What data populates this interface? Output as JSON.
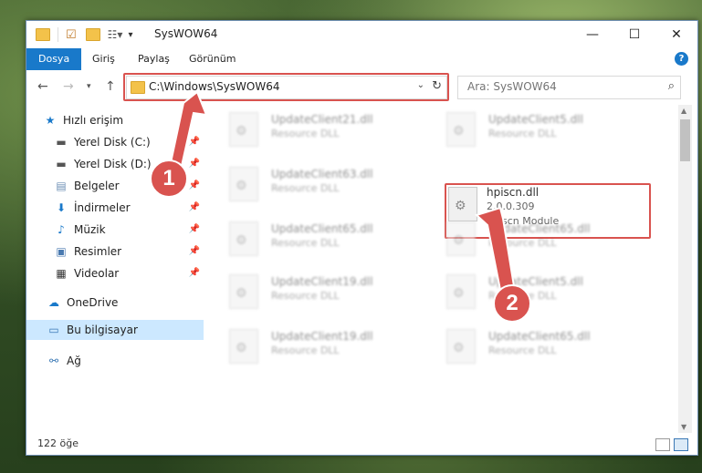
{
  "window": {
    "title": "SysWOW64",
    "buttons": {
      "minimize": "—",
      "maximize": "☐",
      "close": "✕"
    }
  },
  "ribbon": {
    "tabs": [
      "Dosya",
      "Giriş",
      "Paylaş",
      "Görünüm"
    ],
    "help": "?"
  },
  "nav": {
    "address": "C:\\Windows\\SysWOW64",
    "search_placeholder": "Ara: SysWOW64"
  },
  "sidebar": {
    "items": [
      {
        "label": "Hızlı erişim",
        "icon": "star-icon"
      },
      {
        "label": "Yerel Disk (C:)",
        "icon": "disk-icon"
      },
      {
        "label": "Yerel Disk (D:)",
        "icon": "disk-icon"
      },
      {
        "label": "Belgeler",
        "icon": "documents-icon"
      },
      {
        "label": "İndirmeler",
        "icon": "download-icon"
      },
      {
        "label": "Müzik",
        "icon": "music-icon"
      },
      {
        "label": "Resimler",
        "icon": "pictures-icon"
      },
      {
        "label": "Videolar",
        "icon": "videos-icon"
      },
      {
        "label": "OneDrive",
        "icon": "cloud-icon"
      },
      {
        "label": "Bu bilgisayar",
        "icon": "computer-icon"
      },
      {
        "label": "Ağ",
        "icon": "network-icon"
      }
    ]
  },
  "files": {
    "highlight": {
      "name": "hpiscn.dll",
      "version": "2.0.0.309",
      "description": "hpiscn Module"
    },
    "blurred": [
      {
        "name": "UpdateClient21.dll",
        "type": "Resource DLL"
      },
      {
        "name": "UpdateClient5.dll",
        "type": "Resource DLL"
      },
      {
        "name": "UpdateClient63.dll",
        "type": "Resource DLL"
      },
      {
        "name": "UpdateClient65.dll",
        "type": "Resource DLL"
      },
      {
        "name": "UpdateClient65.dll",
        "type": "Resource DLL"
      },
      {
        "name": "UpdateClient19.dll",
        "type": "Resource DLL"
      },
      {
        "name": "UpdateClient5.dll",
        "type": "Resource DLL"
      },
      {
        "name": "UpdateClient19.dll",
        "type": "Resource DLL"
      },
      {
        "name": "UpdateClient65.dll",
        "type": "Resource DLL"
      }
    ]
  },
  "status": {
    "count": "122 öğe"
  },
  "annotations": {
    "badge1": "1",
    "badge2": "2"
  },
  "colors": {
    "accent": "#1979ca",
    "highlight": "#d9534f",
    "selected": "#cce8ff"
  }
}
